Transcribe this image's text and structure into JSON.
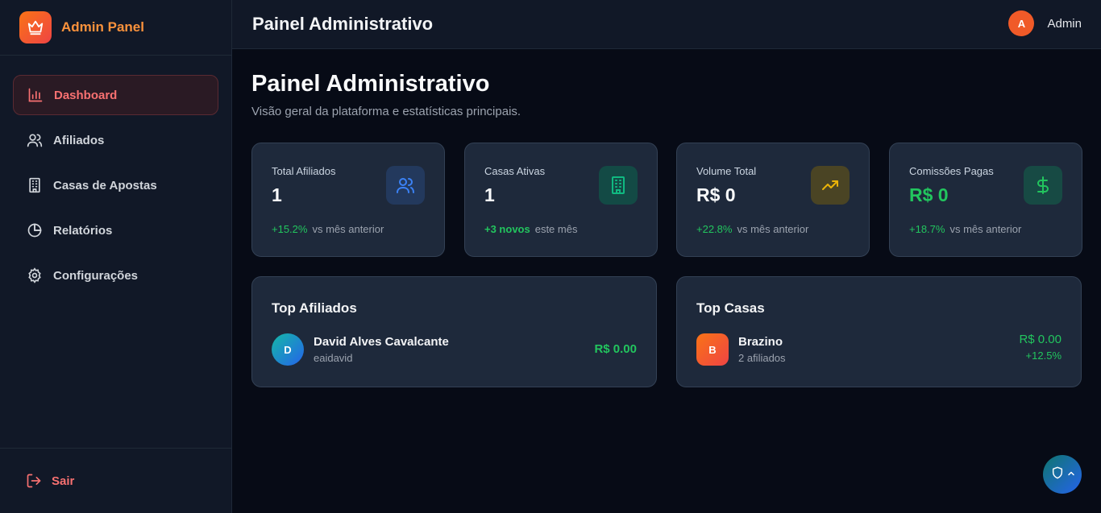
{
  "brand": {
    "title": "Admin Panel",
    "icon": "crown-icon"
  },
  "sidebar": {
    "items": [
      {
        "label": "Dashboard",
        "icon": "bar-chart-icon",
        "active": true
      },
      {
        "label": "Afiliados",
        "icon": "users-icon"
      },
      {
        "label": "Casas de Apostas",
        "icon": "building-icon"
      },
      {
        "label": "Relatórios",
        "icon": "pie-chart-icon"
      },
      {
        "label": "Configurações",
        "icon": "gear-icon"
      }
    ],
    "logout": {
      "label": "Sair",
      "icon": "logout-icon"
    }
  },
  "header": {
    "title": "Painel Administrativo",
    "user": {
      "initial": "A",
      "name": "Admin"
    }
  },
  "page": {
    "title": "Painel Administrativo",
    "subtitle": "Visão geral da plataforma e estatísticas principais."
  },
  "stats": [
    {
      "label": "Total Afiliados",
      "value": "1",
      "delta": "+15.2%",
      "note": "vs mês anterior",
      "icon": "users-icon",
      "color": "#3b82f6"
    },
    {
      "label": "Casas Ativas",
      "value": "1",
      "delta": "+3 novos",
      "note": "este mês",
      "icon": "building-icon",
      "color": "#10b981"
    },
    {
      "label": "Volume Total",
      "value": "R$ 0",
      "delta": "+22.8%",
      "note": "vs mês anterior",
      "icon": "trending-up-icon",
      "color": "#eab308"
    },
    {
      "label": "Comissões Pagas",
      "value": "R$ 0",
      "delta": "+18.7%",
      "note": "vs mês anterior",
      "icon": "dollar-icon",
      "color": "#22c55e"
    }
  ],
  "top_affiliates": {
    "title": "Top Afiliados",
    "rows": [
      {
        "initial": "D",
        "name": "David Alves Cavalcante",
        "handle": "eaidavid",
        "amount": "R$ 0.00"
      }
    ]
  },
  "top_houses": {
    "title": "Top Casas",
    "rows": [
      {
        "initial": "B",
        "name": "Brazino",
        "affiliates": "2 afiliados",
        "amount": "R$ 0.00",
        "growth": "+12.5%"
      }
    ]
  },
  "fab": {
    "icons": [
      "shield-icon",
      "chevron-up-icon"
    ]
  }
}
